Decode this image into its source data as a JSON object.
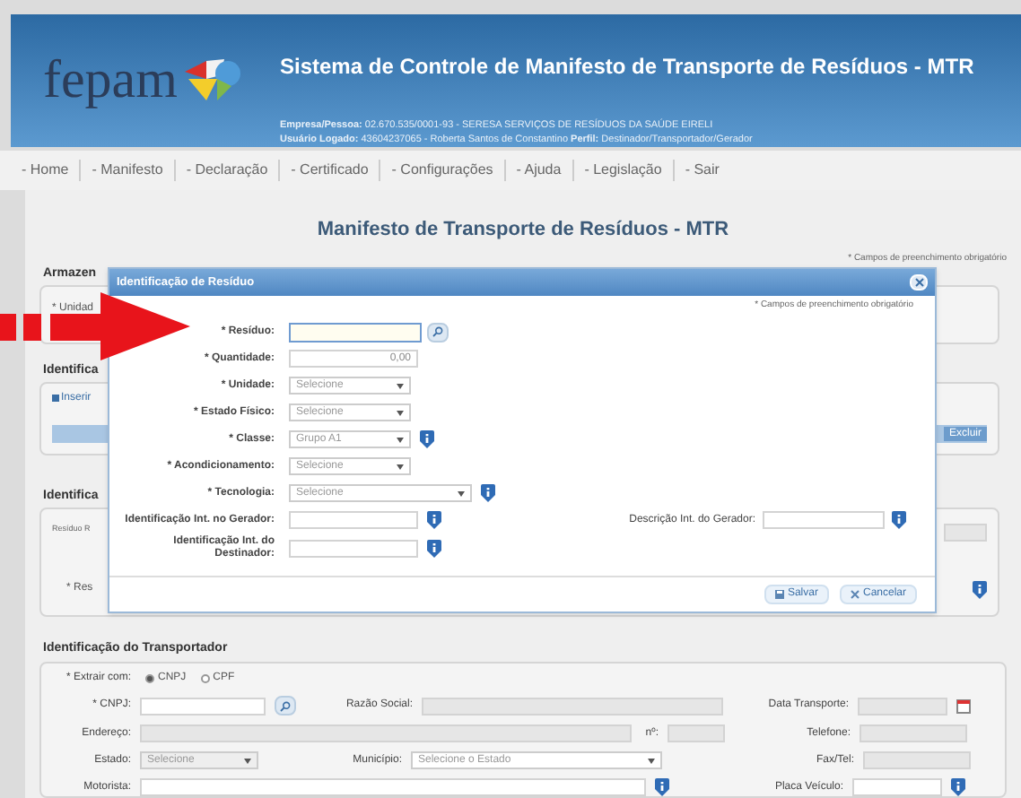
{
  "header": {
    "logo": "fepam",
    "title": "Sistema de Controle de Manifesto de Transporte de Resíduos - MTR",
    "company_line": "**Empresa/Pessoa:** 02.670.535/0001-93 - SERESA SERVIÇOS DE RESÍDUOS DA SAÚDE EIRELI",
    "user_line": "**Usuário Logado:** 43604237065 - Roberta Santos de Constantino **Perfil:** Destinador/Transportador/Gerador"
  },
  "nav": [
    {
      "label": "- Home"
    },
    {
      "label": "- Manifesto"
    },
    {
      "label": "- Declaração"
    },
    {
      "label": "- Certificado"
    },
    {
      "label": "- Configurações"
    },
    {
      "label": "- Ajuda"
    },
    {
      "label": "- Legislação"
    },
    {
      "label": "- Sair"
    }
  ],
  "page_title": "Manifesto de Transporte de Resíduos - MTR",
  "background": {
    "required_note": "* Campos de preenchimento obrigatório",
    "section_1": {
      "title": "Armazen",
      "field": "* Unidad"
    },
    "section_2": {
      "title": "Identifica",
      "add_button": "Inserir",
      "remove_button": "Excluir"
    },
    "section_3": {
      "title": "Identifica",
      "small_label": "Resíduo R",
      "field": "* Res"
    }
  },
  "modal": {
    "title": "Identificação de Resíduo",
    "required_note": "* Campos de preenchimento obrigatório",
    "fields": [
      {
        "kind": "search_input",
        "label": "* Resíduo:",
        "focused": true,
        "info": false
      },
      {
        "kind": "number",
        "label": "* Quantidade:",
        "value": "0,00",
        "info": false
      },
      {
        "kind": "select",
        "label": "* Unidade:",
        "value": "Selecione",
        "wide": false,
        "info": false
      },
      {
        "kind": "select",
        "label": "* Estado Físico:",
        "value": "Selecione",
        "wide": false,
        "info": false
      },
      {
        "kind": "select",
        "label": "* Classe:",
        "value": "Grupo A1",
        "wide": false,
        "info": true
      },
      {
        "kind": "select",
        "label": "* Acondicionamento:",
        "value": "Selecione",
        "wide": false,
        "info": false
      },
      {
        "kind": "select",
        "label": "* Tecnologia:",
        "value": "Selecione",
        "wide": true,
        "info": true
      },
      {
        "kind": "input",
        "label": "Identificação Int. no Gerador:",
        "info": true,
        "side": {
          "label": "Descrição Int. do Gerador:",
          "info": true
        }
      },
      {
        "kind": "input",
        "label": "Identificação Int. do Destinador:",
        "info": true
      }
    ],
    "buttons": [
      {
        "kind": "save",
        "label": "Salvar"
      },
      {
        "kind": "cancel",
        "label": "Cancelar"
      }
    ]
  },
  "transporter": {
    "title": "Identificação do Transportador",
    "extract_label": "* Extrair com:",
    "radios": [
      {
        "label": "CNPJ",
        "selected": true
      },
      {
        "label": "CPF",
        "selected": false
      }
    ],
    "cnpj_label": "* CNPJ:",
    "razao_label": "Razão Social:",
    "date_label": "Data Transporte:",
    "address_label": "Endereço:",
    "number_label": "nº:",
    "phone_label": "Telefone:",
    "state_label": "Estado:",
    "state_value": "Selecione",
    "city_label": "Município:",
    "city_value": "Selecione o Estado",
    "fax_label": "Fax/Tel:",
    "driver_label": "Motorista:",
    "plate_label": "Placa Veículo:"
  }
}
